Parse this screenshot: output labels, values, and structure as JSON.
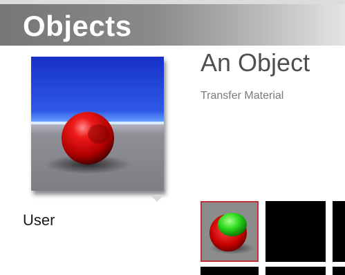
{
  "header": {
    "title": "Objects"
  },
  "object": {
    "name": "An Object",
    "subtitle": "Transfer Material"
  },
  "preview": {
    "icon": "material-preview-red-sphere"
  },
  "user": {
    "label": "User"
  },
  "materials": [
    {
      "icon": "red-green-sphere-icon",
      "selected": true
    },
    {
      "icon": "empty-slot",
      "selected": false
    },
    {
      "icon": "empty-slot",
      "selected": false
    }
  ],
  "colors": {
    "accent_selected": "#c0303a",
    "sky": "#1f3fd0",
    "floor": "#8c8c8c"
  }
}
